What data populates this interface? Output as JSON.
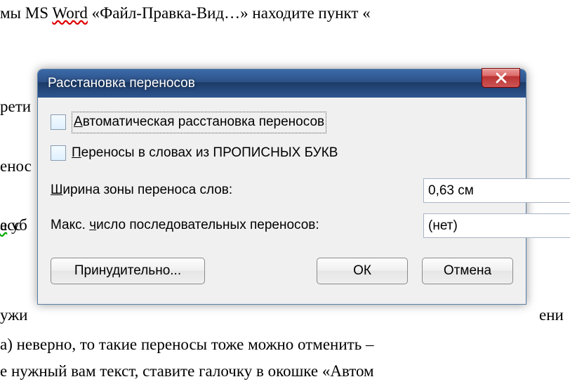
{
  "bg": {
    "line1_a": "мы MS ",
    "line1_word": "Word",
    "line1_b": " «Файл-Правка-Вид…» находите пункт «",
    "line2": "рети",
    "line3": "енос",
    "line4_a": "е",
    "line4_b": " уб",
    "line4_c": "асс",
    "line5_a": "ужи",
    "line5_b": "ени",
    "line6": "а) неверно, то такие переносы тоже можно отменить –",
    "line7": "е нужный вам текст, ставите галочку в окошке «Автом"
  },
  "dialog": {
    "title": "Расстановка переносов",
    "checkbox1_pre": "",
    "checkbox1_u": "А",
    "checkbox1_post": "втоматическая расстановка переносов",
    "checkbox2_pre": "",
    "checkbox2_u": "П",
    "checkbox2_post": "ереносы в словах из ПРОПИСНЫХ БУКВ",
    "field1_pre": "",
    "field1_u": "Ш",
    "field1_post": "ирина зоны переноса слов:",
    "field1_value": "0,63 см",
    "field2_pre": "Макс. ",
    "field2_u": "ч",
    "field2_post": "исло последовательных переносов:",
    "field2_value": "(нет)",
    "btn_force": "Принудительно...",
    "btn_ok": "ОК",
    "btn_cancel": "Отмена"
  }
}
